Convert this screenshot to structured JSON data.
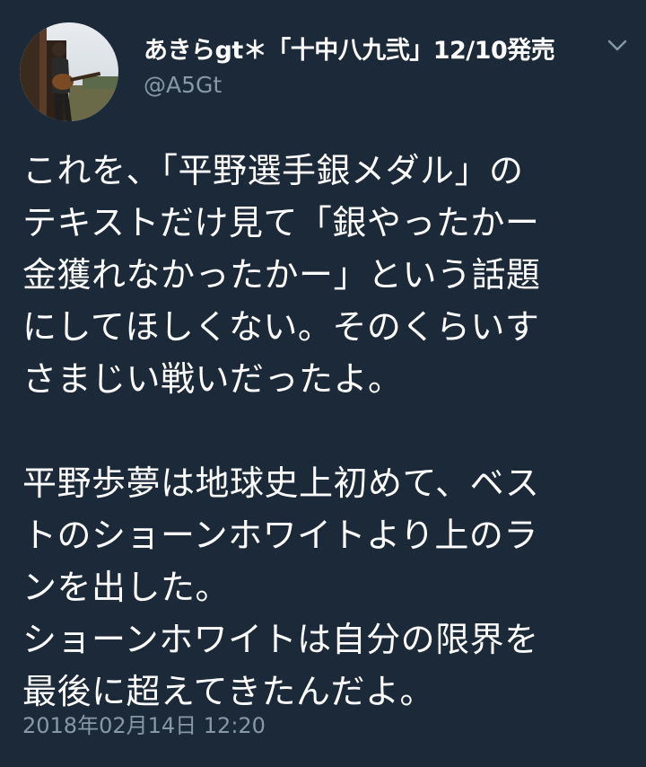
{
  "tweet": {
    "display_name": "あきらgt＊「十中八九弐」12/10発売",
    "handle": "@A5Gt",
    "menu_icon": "chevron-down-icon",
    "avatar_icon": "user-avatar-guitarist",
    "body": "これを、「平野選手銀メダル」の\nテキストだけ見て「銀やったかー\n金獲れなかったかー」という話題\nにしてほしくない。そのくらいす\nさまじい戦いだったよ。\n\n平野歩夢は地球史上初めて、ベス\nトのショーンホワイトより上のラ\nンを出した。\nショーンホワイトは自分の限界を\n最後に超えてきたんだよ。",
    "timestamp": "2018年02月14日 12:20"
  },
  "colors": {
    "background": "#1c2938",
    "text": "#ffffff",
    "secondary_text": "#8899a6"
  }
}
